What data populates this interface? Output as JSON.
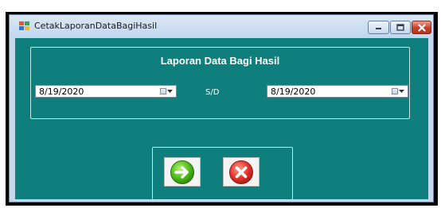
{
  "window": {
    "title": "CetakLaporanDataBagiHasil",
    "app_icon": "windows-form-icon",
    "controls": {
      "minimize_icon": "minimize-icon",
      "maximize_icon": "maximize-icon",
      "close_icon": "close-icon"
    }
  },
  "form": {
    "heading": "Laporan Data Bagi Hasil",
    "date_from": {
      "value": "8/19/2020",
      "icon": "calendar-dropdown-icon"
    },
    "separator_label": "S/D",
    "date_to": {
      "value": "8/19/2020",
      "icon": "calendar-dropdown-icon"
    }
  },
  "actions": {
    "ok_icon": "green-arrow-right-icon",
    "cancel_icon": "red-x-icon"
  },
  "colors": {
    "client_bg": "#0e7f7c",
    "titlebar_bg": "#c6d8ec",
    "ok_green": "#4cbb17",
    "cancel_red": "#e2322a"
  }
}
